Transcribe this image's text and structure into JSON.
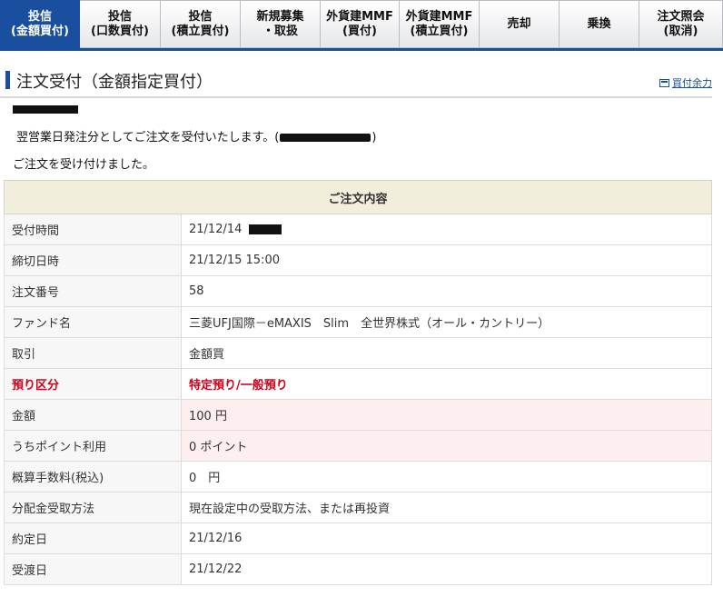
{
  "tabs": [
    {
      "label": "投信\n(金額買付)",
      "active": true
    },
    {
      "label": "投信\n(口数買付)",
      "active": false
    },
    {
      "label": "投信\n(積立買付)",
      "active": false
    },
    {
      "label": "新規募集\n・取扱",
      "active": false
    },
    {
      "label": "外貨建MMF\n(買付)",
      "active": false
    },
    {
      "label": "外貨建MMF\n(積立買付)",
      "active": false
    },
    {
      "label": "売却",
      "active": false
    },
    {
      "label": "乗換",
      "active": false
    },
    {
      "label": "注文照会\n(取消)",
      "active": false
    }
  ],
  "page": {
    "title": "注文受付（金額指定買付）",
    "buying_power_link": "買付余力",
    "message_line1_before": "翌営業日発注分としてご注文を受付いたします。(",
    "message_line1_after": ")",
    "message_line2": "ご注文を受け付けました。"
  },
  "order": {
    "header": "ご注文内容",
    "rows": [
      {
        "label": "受付時間",
        "value": "21/12/14"
      },
      {
        "label": "締切日時",
        "value": "21/12/15 15:00"
      },
      {
        "label": "注文番号",
        "value": "58"
      },
      {
        "label": "ファンド名",
        "value": "三菱UFJ国際－eMAXIS　Slim　全世界株式（オール・カントリー）"
      },
      {
        "label": "取引",
        "value": "金額買"
      },
      {
        "label": "預り区分",
        "value": "特定預り/一般預り"
      },
      {
        "label": "金額",
        "value": "100 円"
      },
      {
        "label": "うちポイント利用",
        "value": "0 ポイント"
      },
      {
        "label": "概算手数料(税込)",
        "value": "0　円"
      },
      {
        "label": "分配金受取方法",
        "value": "現在設定中の受取方法、または再投資"
      },
      {
        "label": "約定日",
        "value": "21/12/16"
      },
      {
        "label": "受渡日",
        "value": "21/12/22"
      }
    ]
  },
  "colors": {
    "accent": "#1a4fa0",
    "highlight_text": "#d0021b",
    "header_bg": "#f1eedb",
    "pink_row": "#fdeef0"
  }
}
